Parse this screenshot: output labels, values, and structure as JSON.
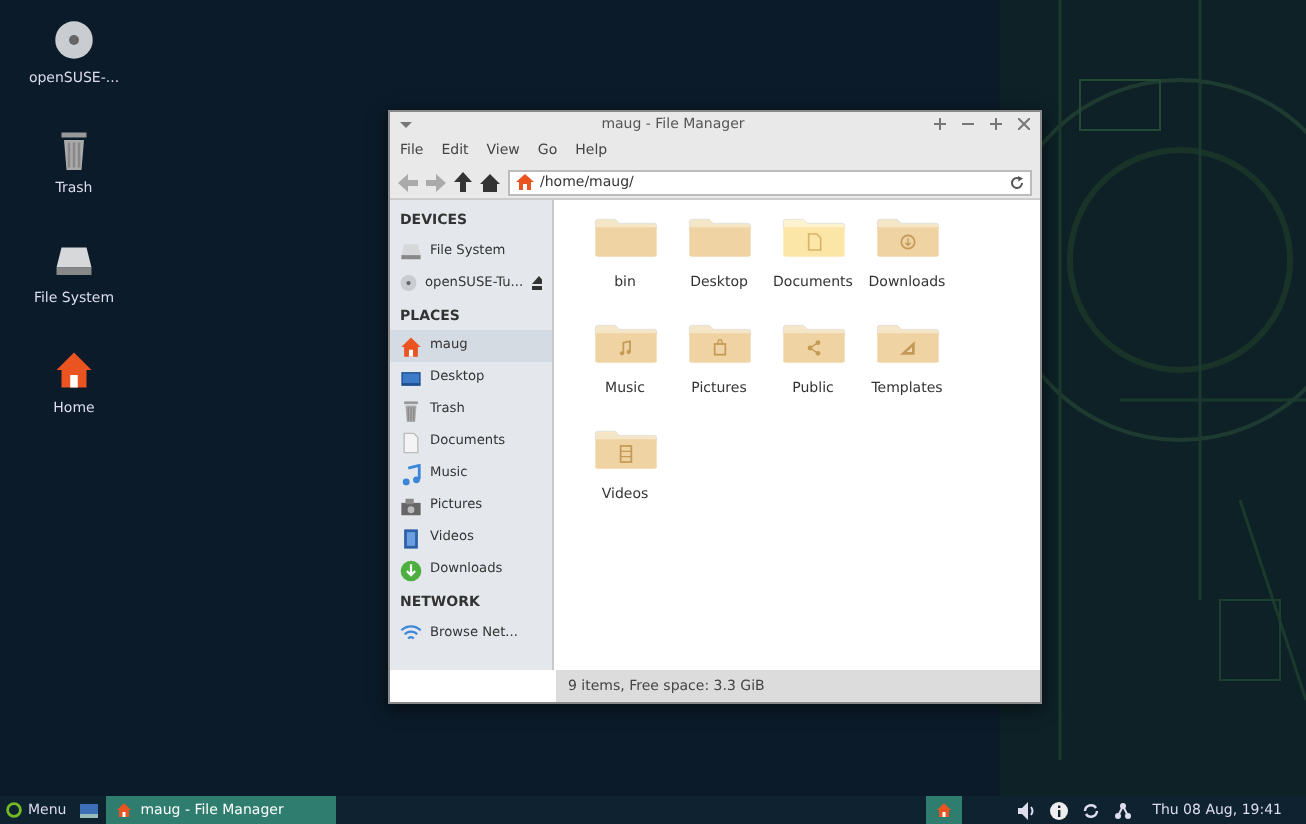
{
  "desktop_icons": [
    {
      "label": "openSUSE-...",
      "kind": "disc"
    },
    {
      "label": "Trash",
      "kind": "trash"
    },
    {
      "label": "File System",
      "kind": "drive"
    },
    {
      "label": "Home",
      "kind": "home"
    }
  ],
  "window": {
    "title": "maug - File Manager",
    "menu": [
      "File",
      "Edit",
      "View",
      "Go",
      "Help"
    ],
    "address": "/home/maug/",
    "sidebar": [
      {
        "heading": "DEVICES",
        "items": [
          {
            "label": "File System",
            "kind": "drive",
            "selected": false,
            "eject": false
          },
          {
            "label": "openSUSE-Tu...",
            "kind": "disc",
            "selected": false,
            "eject": true
          }
        ]
      },
      {
        "heading": "PLACES",
        "items": [
          {
            "label": "maug",
            "kind": "home",
            "selected": true,
            "eject": false
          },
          {
            "label": "Desktop",
            "kind": "desktop",
            "selected": false,
            "eject": false
          },
          {
            "label": "Trash",
            "kind": "trash",
            "selected": false,
            "eject": false
          },
          {
            "label": "Documents",
            "kind": "doc",
            "selected": false,
            "eject": false
          },
          {
            "label": "Music",
            "kind": "music",
            "selected": false,
            "eject": false
          },
          {
            "label": "Pictures",
            "kind": "pictures",
            "selected": false,
            "eject": false
          },
          {
            "label": "Videos",
            "kind": "video",
            "selected": false,
            "eject": false
          },
          {
            "label": "Downloads",
            "kind": "download",
            "selected": false,
            "eject": false
          }
        ]
      },
      {
        "heading": "NETWORK",
        "items": [
          {
            "label": "Browse Net...",
            "kind": "network",
            "selected": false,
            "eject": false
          }
        ]
      }
    ],
    "files": [
      {
        "name": "bin",
        "kind": "plain",
        "highlighted": false
      },
      {
        "name": "Desktop",
        "kind": "plain",
        "highlighted": false
      },
      {
        "name": "Documents",
        "kind": "doc",
        "highlighted": true
      },
      {
        "name": "Downloads",
        "kind": "download",
        "highlighted": false
      },
      {
        "name": "Music",
        "kind": "music",
        "highlighted": false
      },
      {
        "name": "Pictures",
        "kind": "pictures",
        "highlighted": false
      },
      {
        "name": "Public",
        "kind": "share",
        "highlighted": false
      },
      {
        "name": "Templates",
        "kind": "templates",
        "highlighted": false
      },
      {
        "name": "Videos",
        "kind": "video",
        "highlighted": false
      }
    ],
    "status": "9 items, Free space: 3.3 GiB"
  },
  "taskbar": {
    "menu": "Menu",
    "tasks": [
      {
        "label": "maug - File Manager",
        "selected": true
      }
    ],
    "clock": "Thu 08 Aug, 19:41"
  }
}
